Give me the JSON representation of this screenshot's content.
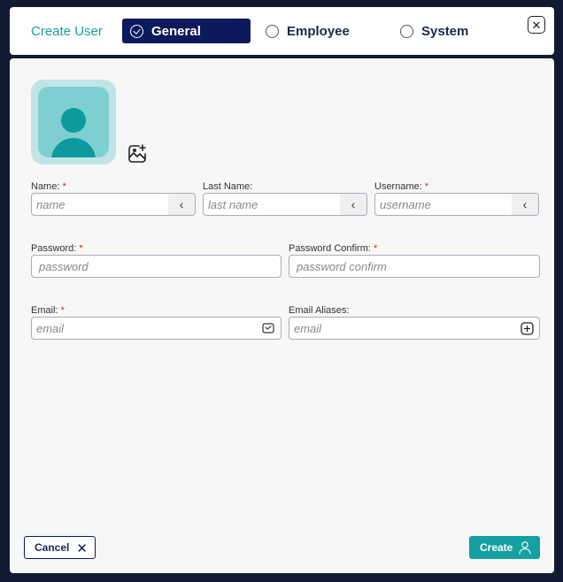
{
  "header": {
    "title": "Create User",
    "tabs": [
      {
        "label": "General",
        "selected": true
      },
      {
        "label": "Employee",
        "selected": false
      },
      {
        "label": "System",
        "selected": false
      }
    ],
    "close_icon": "close-icon"
  },
  "form": {
    "name": {
      "label": "Name:",
      "required": "*",
      "placeholder": "name"
    },
    "last_name": {
      "label": "Last Name:",
      "placeholder": "last name"
    },
    "username": {
      "label": "Username:",
      "required": "*",
      "placeholder": "username"
    },
    "password": {
      "label": "Password:",
      "required": "*",
      "placeholder": "password"
    },
    "password_confirm": {
      "label": "Password Confirm:",
      "required": "*",
      "placeholder": "password confirm"
    },
    "email": {
      "label": "Email:",
      "required": "*",
      "placeholder": "email"
    },
    "email_aliases": {
      "label": "Email Aliases:",
      "placeholder": "email"
    }
  },
  "footer": {
    "cancel_label": "Cancel",
    "create_label": "Create"
  },
  "colors": {
    "accent": "#14a0a0",
    "primary": "#0c1a5c",
    "required": "#dd2222"
  }
}
